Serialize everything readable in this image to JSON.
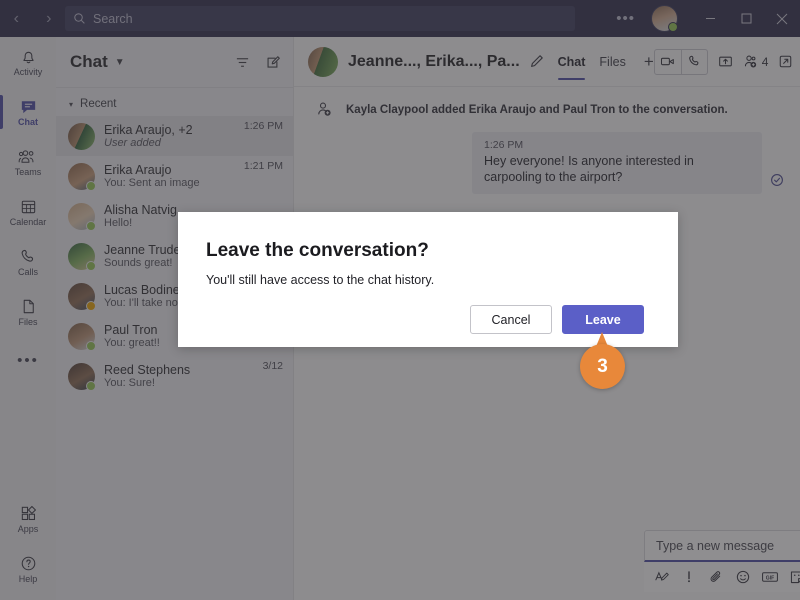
{
  "titlebar": {
    "back_icon": "back-arrow-icon",
    "forward_icon": "forward-arrow-icon",
    "search_placeholder": "Search",
    "more_label": "•••",
    "minimize_label": "minimize",
    "maximize_label": "maximize",
    "close_label": "close",
    "presence": "available"
  },
  "rail": {
    "items": [
      {
        "label": "Activity",
        "icon": "bell-icon",
        "active": false
      },
      {
        "label": "Chat",
        "icon": "chat-bubble-icon",
        "active": true
      },
      {
        "label": "Teams",
        "icon": "people-icon",
        "active": false
      },
      {
        "label": "Calendar",
        "icon": "calendar-icon",
        "active": false
      },
      {
        "label": "Calls",
        "icon": "phone-icon",
        "active": false
      },
      {
        "label": "Files",
        "icon": "file-icon",
        "active": false
      }
    ],
    "more_label": "•••",
    "bottom": [
      {
        "label": "Apps",
        "icon": "apps-icon"
      },
      {
        "label": "Help",
        "icon": "help-icon"
      }
    ]
  },
  "chatlist": {
    "title": "Chat",
    "chevron": "▼",
    "filter_icon": "filter-icon",
    "compose_icon": "new-chat-icon",
    "section_label": "Recent",
    "section_caret": "▾",
    "items": [
      {
        "name": "Erika Araujo, +2",
        "preview": "User added",
        "time": "1:26 PM",
        "selected": true,
        "italic": true,
        "presence": "none",
        "avatar": "linear-gradient(115deg,#6b4f3d 0%,#b08a68 46%,#2f5f3a 47%,#8fb96a 100%)"
      },
      {
        "name": "Erika Araujo",
        "preview": "You: Sent an image",
        "time": "1:21 PM",
        "selected": false,
        "italic": false,
        "presence": "available",
        "avatar": "linear-gradient(150deg,#8a6347 0%,#c49a78 60%,#4a5d72 100%)"
      },
      {
        "name": "Alisha Natvig",
        "preview": "Hello!",
        "time": "",
        "selected": false,
        "italic": false,
        "presence": "available",
        "avatar": "linear-gradient(150deg,#c9a784 0%,#e3cbb0 55%,#9aa7b4 100%)"
      },
      {
        "name": "Jeanne Trudea",
        "preview": "Sounds great!",
        "time": "",
        "selected": false,
        "italic": false,
        "presence": "available",
        "avatar": "linear-gradient(150deg,#2f5f3a 0%,#7fae5c 55%,#d8c49a 100%)"
      },
      {
        "name": "Lucas Bodine",
        "preview": "You: I'll take note",
        "time": "",
        "selected": false,
        "italic": false,
        "presence": "away",
        "avatar": "linear-gradient(150deg,#5a4336 0%,#8c6a52 55%,#3c4a5e 100%)"
      },
      {
        "name": "Paul Tron",
        "preview": "You: great!!",
        "time": "",
        "selected": false,
        "italic": false,
        "presence": "available",
        "avatar": "linear-gradient(150deg,#7a5c44 0%,#b89173 55%,#cfd6dd 100%)"
      },
      {
        "name": "Reed Stephens",
        "preview": "You: Sure!",
        "time": "3/12",
        "selected": false,
        "italic": false,
        "presence": "available",
        "avatar": "linear-gradient(150deg,#4a3830 0%,#8a6a52 55%,#2f3b4a 100%)"
      }
    ]
  },
  "conversation": {
    "title": "Jeanne..., Erika..., Pa...",
    "edit_icon": "pencil-icon",
    "tabs": [
      {
        "label": "Chat",
        "active": true
      },
      {
        "label": "Files",
        "active": false
      }
    ],
    "add_tab_label": "+",
    "video_icon": "video-call-icon",
    "audio_icon": "audio-call-icon",
    "share_icon": "share-screen-icon",
    "people_icon": "add-people-icon",
    "people_count": "4",
    "popout_icon": "pop-out-icon",
    "system_message": "Kayla Claypool added Erika Araujo and Paul Tron to the conversation.",
    "system_icon": "person-added-icon",
    "messages": [
      {
        "time": "1:26 PM",
        "text": "Hey everyone! Is anyone interested in carpooling to the airport?",
        "outgoing": true,
        "status_icon": "seen-check-icon"
      }
    ]
  },
  "compose": {
    "placeholder": "Type a new message",
    "tools": [
      {
        "icon": "format-text-icon"
      },
      {
        "icon": "set-importance-icon"
      },
      {
        "icon": "attach-file-icon"
      },
      {
        "icon": "emoji-icon"
      },
      {
        "icon": "giphy-icon"
      },
      {
        "icon": "sticker-icon"
      },
      {
        "icon": "meet-now-icon"
      },
      {
        "icon": "stream-icon"
      },
      {
        "icon": "praise-icon"
      },
      {
        "icon": "loop-icon"
      },
      {
        "icon": "youtube-icon"
      },
      {
        "icon": "more-options-icon"
      }
    ],
    "send_icon": "send-icon"
  },
  "dialog": {
    "title": "Leave the conversation?",
    "body": "You'll still have access to the chat history.",
    "cancel_label": "Cancel",
    "confirm_label": "Leave"
  },
  "callout": {
    "number": "3"
  },
  "colors": {
    "brand_purple": "#5b5fc7",
    "rail_active": "#4b4ba3",
    "titlebar": "#2d2c4a",
    "callout_orange": "#e8883a",
    "presence_available": "#92c353",
    "presence_away": "#e8a200"
  }
}
